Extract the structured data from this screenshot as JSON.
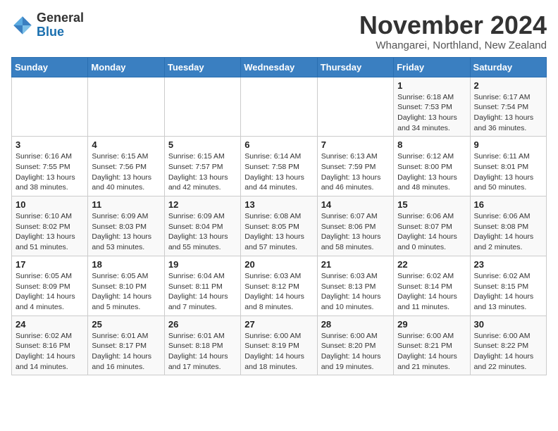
{
  "header": {
    "logo_general": "General",
    "logo_blue": "Blue",
    "month_title": "November 2024",
    "location": "Whangarei, Northland, New Zealand"
  },
  "days_of_week": [
    "Sunday",
    "Monday",
    "Tuesday",
    "Wednesday",
    "Thursday",
    "Friday",
    "Saturday"
  ],
  "weeks": [
    [
      {
        "day": "",
        "info": ""
      },
      {
        "day": "",
        "info": ""
      },
      {
        "day": "",
        "info": ""
      },
      {
        "day": "",
        "info": ""
      },
      {
        "day": "",
        "info": ""
      },
      {
        "day": "1",
        "info": "Sunrise: 6:18 AM\nSunset: 7:53 PM\nDaylight: 13 hours\nand 34 minutes."
      },
      {
        "day": "2",
        "info": "Sunrise: 6:17 AM\nSunset: 7:54 PM\nDaylight: 13 hours\nand 36 minutes."
      }
    ],
    [
      {
        "day": "3",
        "info": "Sunrise: 6:16 AM\nSunset: 7:55 PM\nDaylight: 13 hours\nand 38 minutes."
      },
      {
        "day": "4",
        "info": "Sunrise: 6:15 AM\nSunset: 7:56 PM\nDaylight: 13 hours\nand 40 minutes."
      },
      {
        "day": "5",
        "info": "Sunrise: 6:15 AM\nSunset: 7:57 PM\nDaylight: 13 hours\nand 42 minutes."
      },
      {
        "day": "6",
        "info": "Sunrise: 6:14 AM\nSunset: 7:58 PM\nDaylight: 13 hours\nand 44 minutes."
      },
      {
        "day": "7",
        "info": "Sunrise: 6:13 AM\nSunset: 7:59 PM\nDaylight: 13 hours\nand 46 minutes."
      },
      {
        "day": "8",
        "info": "Sunrise: 6:12 AM\nSunset: 8:00 PM\nDaylight: 13 hours\nand 48 minutes."
      },
      {
        "day": "9",
        "info": "Sunrise: 6:11 AM\nSunset: 8:01 PM\nDaylight: 13 hours\nand 50 minutes."
      }
    ],
    [
      {
        "day": "10",
        "info": "Sunrise: 6:10 AM\nSunset: 8:02 PM\nDaylight: 13 hours\nand 51 minutes."
      },
      {
        "day": "11",
        "info": "Sunrise: 6:09 AM\nSunset: 8:03 PM\nDaylight: 13 hours\nand 53 minutes."
      },
      {
        "day": "12",
        "info": "Sunrise: 6:09 AM\nSunset: 8:04 PM\nDaylight: 13 hours\nand 55 minutes."
      },
      {
        "day": "13",
        "info": "Sunrise: 6:08 AM\nSunset: 8:05 PM\nDaylight: 13 hours\nand 57 minutes."
      },
      {
        "day": "14",
        "info": "Sunrise: 6:07 AM\nSunset: 8:06 PM\nDaylight: 13 hours\nand 58 minutes."
      },
      {
        "day": "15",
        "info": "Sunrise: 6:06 AM\nSunset: 8:07 PM\nDaylight: 14 hours\nand 0 minutes."
      },
      {
        "day": "16",
        "info": "Sunrise: 6:06 AM\nSunset: 8:08 PM\nDaylight: 14 hours\nand 2 minutes."
      }
    ],
    [
      {
        "day": "17",
        "info": "Sunrise: 6:05 AM\nSunset: 8:09 PM\nDaylight: 14 hours\nand 4 minutes."
      },
      {
        "day": "18",
        "info": "Sunrise: 6:05 AM\nSunset: 8:10 PM\nDaylight: 14 hours\nand 5 minutes."
      },
      {
        "day": "19",
        "info": "Sunrise: 6:04 AM\nSunset: 8:11 PM\nDaylight: 14 hours\nand 7 minutes."
      },
      {
        "day": "20",
        "info": "Sunrise: 6:03 AM\nSunset: 8:12 PM\nDaylight: 14 hours\nand 8 minutes."
      },
      {
        "day": "21",
        "info": "Sunrise: 6:03 AM\nSunset: 8:13 PM\nDaylight: 14 hours\nand 10 minutes."
      },
      {
        "day": "22",
        "info": "Sunrise: 6:02 AM\nSunset: 8:14 PM\nDaylight: 14 hours\nand 11 minutes."
      },
      {
        "day": "23",
        "info": "Sunrise: 6:02 AM\nSunset: 8:15 PM\nDaylight: 14 hours\nand 13 minutes."
      }
    ],
    [
      {
        "day": "24",
        "info": "Sunrise: 6:02 AM\nSunset: 8:16 PM\nDaylight: 14 hours\nand 14 minutes."
      },
      {
        "day": "25",
        "info": "Sunrise: 6:01 AM\nSunset: 8:17 PM\nDaylight: 14 hours\nand 16 minutes."
      },
      {
        "day": "26",
        "info": "Sunrise: 6:01 AM\nSunset: 8:18 PM\nDaylight: 14 hours\nand 17 minutes."
      },
      {
        "day": "27",
        "info": "Sunrise: 6:00 AM\nSunset: 8:19 PM\nDaylight: 14 hours\nand 18 minutes."
      },
      {
        "day": "28",
        "info": "Sunrise: 6:00 AM\nSunset: 8:20 PM\nDaylight: 14 hours\nand 19 minutes."
      },
      {
        "day": "29",
        "info": "Sunrise: 6:00 AM\nSunset: 8:21 PM\nDaylight: 14 hours\nand 21 minutes."
      },
      {
        "day": "30",
        "info": "Sunrise: 6:00 AM\nSunset: 8:22 PM\nDaylight: 14 hours\nand 22 minutes."
      }
    ]
  ]
}
